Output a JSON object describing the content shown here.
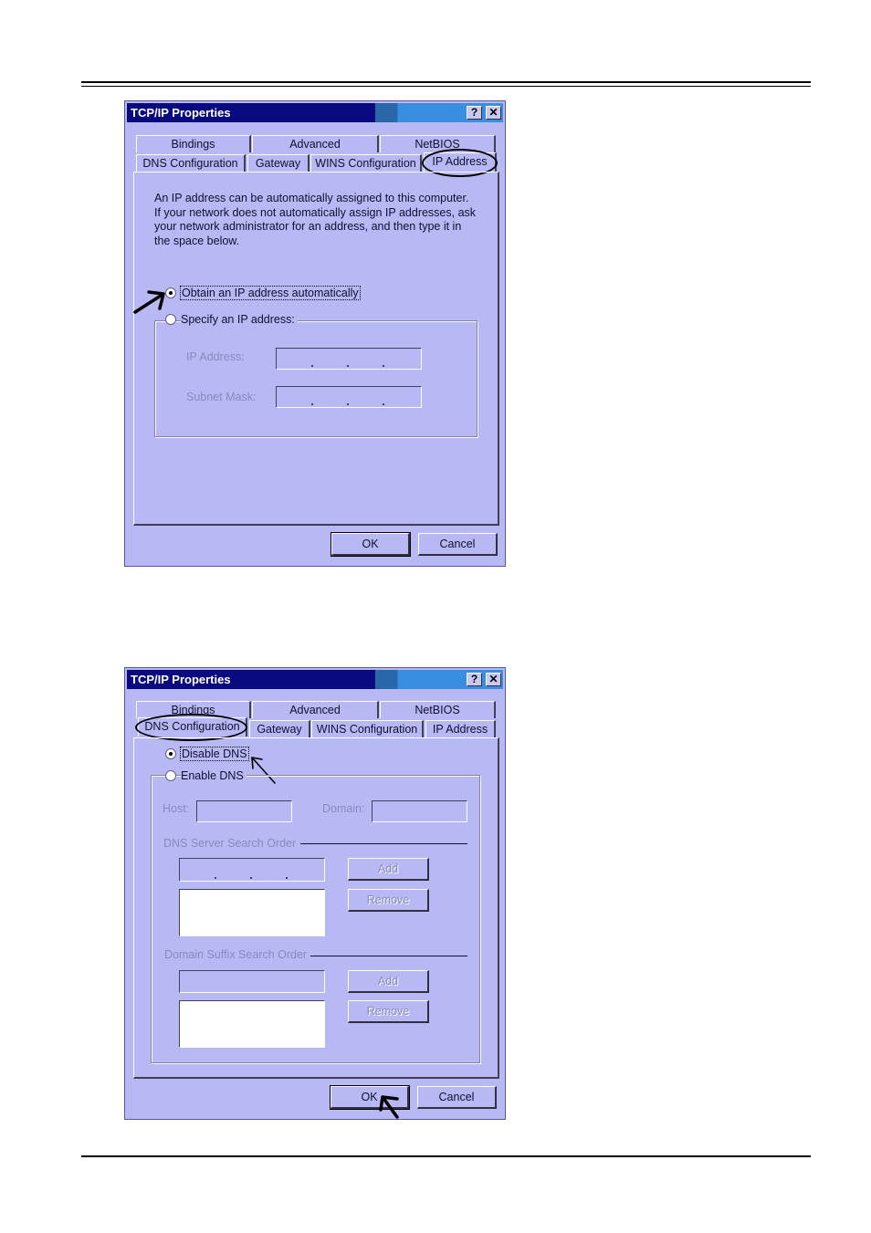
{
  "dialog1": {
    "title": "TCP/IP Properties",
    "help_label": "?",
    "close_label": "✕",
    "tabs_top": [
      "Bindings",
      "Advanced",
      "NetBIOS"
    ],
    "tabs_bottom": [
      "DNS Configuration",
      "Gateway",
      "WINS Configuration",
      "IP Address"
    ],
    "description": [
      "An IP address can be automatically assigned to this computer.",
      "If your network does not automatically assign IP addresses, ask",
      "your network administrator for an address, and then type it in",
      "the space below."
    ],
    "radio_obtain": "Obtain an IP address automatically",
    "radio_specify": "Specify an IP address:",
    "ip_address_label": "IP Address:",
    "subnet_mask_label": "Subnet Mask:",
    "ok_label": "OK",
    "cancel_label": "Cancel"
  },
  "dialog2": {
    "title": "TCP/IP Properties",
    "help_label": "?",
    "close_label": "✕",
    "tabs_top": [
      "Bindings",
      "Advanced",
      "NetBIOS"
    ],
    "tabs_bottom": [
      "DNS Configuration",
      "Gateway",
      "WINS Configuration",
      "IP Address"
    ],
    "radio_disable": "Disable DNS",
    "radio_enable": "Enable DNS",
    "host_label": "Host:",
    "domain_label": "Domain:",
    "dns_server_order": "DNS Server Search Order",
    "domain_suffix_order": "Domain Suffix Search Order",
    "add_label": "Add",
    "remove_label": "Remove",
    "ok_label": "OK",
    "cancel_label": "Cancel"
  },
  "colors": {
    "dialog_bg": "#b8b8f4",
    "title_bar": "#0a0a80"
  },
  "icons": [
    "help-icon",
    "close-icon",
    "arrow-pointer-icon"
  ]
}
